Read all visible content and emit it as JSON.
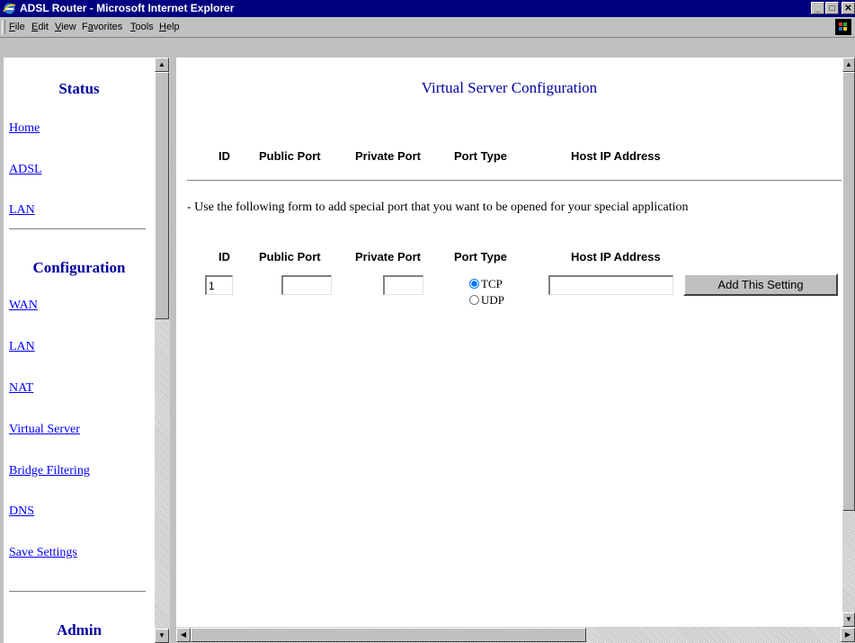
{
  "window": {
    "title": "ADSL Router - Microsoft Internet Explorer",
    "minimize": "_",
    "maximize": "□",
    "close": "✕"
  },
  "menu": {
    "items": [
      {
        "label": "File"
      },
      {
        "label": "Edit"
      },
      {
        "label": "View"
      },
      {
        "label": "Favorites"
      },
      {
        "label": "Tools"
      },
      {
        "label": "Help"
      }
    ]
  },
  "sidebar": {
    "status_heading": "Status",
    "status_links": [
      {
        "label": "Home"
      },
      {
        "label": "ADSL"
      },
      {
        "label": "LAN"
      }
    ],
    "config_heading": "Configuration",
    "config_links": [
      {
        "label": "WAN"
      },
      {
        "label": "LAN"
      },
      {
        "label": "NAT"
      },
      {
        "label": "Virtual Server"
      },
      {
        "label": "Bridge Filtering"
      },
      {
        "label": "DNS"
      },
      {
        "label": "Save Settings"
      }
    ],
    "admin_heading": "Admin"
  },
  "main": {
    "title": "Virtual Server Configuration",
    "table_headers": [
      "ID",
      "Public Port",
      "Private Port",
      "Port Type",
      "Host IP Address"
    ],
    "instruction": "- Use the following form to add special port that you want to be opened for your special application",
    "form": {
      "headers": [
        "ID",
        "Public Port",
        "Private Port",
        "Port Type",
        "Host IP Address"
      ],
      "id_value": "1",
      "public_port_value": "",
      "private_port_value": "",
      "host_ip_value": "",
      "radio_tcp": "TCP",
      "radio_udp": "UDP",
      "selected_port_type": "TCP",
      "submit_label": "Add This Setting"
    }
  }
}
